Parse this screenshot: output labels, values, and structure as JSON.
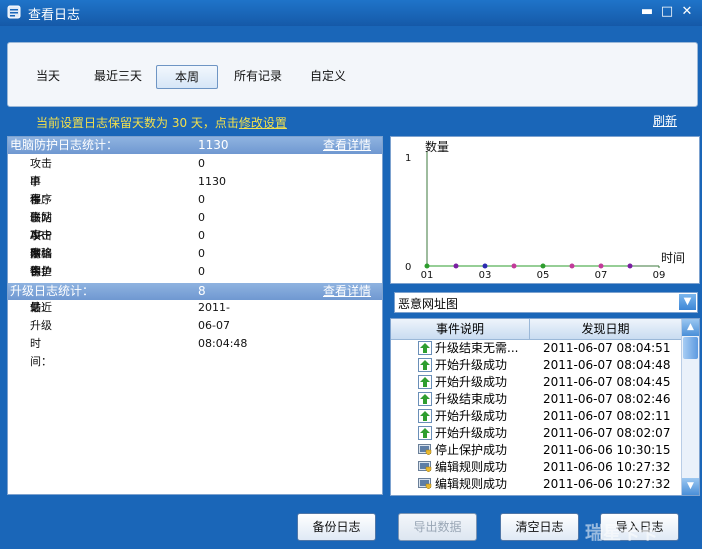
{
  "window": {
    "title": "查看日志"
  },
  "tabs": [
    "当天",
    "最近三天",
    "本周",
    "所有记录",
    "自定义"
  ],
  "active_tab": "本周",
  "notice": {
    "prefix": "当前设置日志保留天数为 30 天，点击",
    "link": "修改设置"
  },
  "refresh_label": "刷新",
  "protection": {
    "header": "电脑防护日志统计：",
    "total": "1130",
    "detail_link": "查看详情",
    "rows": [
      {
        "label": "攻击事件：",
        "value": "0"
      },
      {
        "label": "IP 事件：",
        "value": "1130"
      },
      {
        "label": "程序联网事件：",
        "value": "0"
      },
      {
        "label": "出站攻击事件：",
        "value": "0"
      },
      {
        "label": "ARP 欺骗事件：",
        "value": "0"
      },
      {
        "label": "网络保护事件：",
        "value": "0"
      },
      {
        "label": "钓鱼网站：",
        "value": "0"
      }
    ]
  },
  "upgrade": {
    "header": "升级日志统计：",
    "total": "8",
    "detail_link": "查看详情",
    "rows": [
      {
        "label": "最近升级时间：",
        "value": "2011-06-07 08:04:48"
      }
    ]
  },
  "chart_data": {
    "type": "line",
    "ylabel": "数量",
    "xlabel": "时间",
    "yticks": [
      "0",
      "1"
    ],
    "xticks": [
      "01",
      "03",
      "05",
      "07",
      "09"
    ],
    "ylim": [
      0,
      1
    ],
    "xlim": [
      0,
      8
    ],
    "series": [
      {
        "x": [
          0,
          1,
          2,
          3,
          4,
          5,
          6,
          7
        ],
        "values": [
          0,
          0,
          0,
          0,
          0,
          0,
          0,
          0
        ],
        "point_colors": [
          "#2e9d2e",
          "#7a1fa2",
          "#2b2bb0",
          "#c23b9a",
          "#2e9d2e",
          "#c23b9a",
          "#c23b9a",
          "#7a1fa2"
        ]
      }
    ]
  },
  "chart_selector": "恶意网址图",
  "events": {
    "col_desc": "事件说明",
    "col_date": "发现日期",
    "rows": [
      {
        "icon": "upgrade-icon",
        "desc": "升级结束无需...",
        "date": "2011-06-07 08:04:51"
      },
      {
        "icon": "upgrade-icon",
        "desc": "开始升级成功",
        "date": "2011-06-07 08:04:48"
      },
      {
        "icon": "upgrade-icon",
        "desc": "开始升级成功",
        "date": "2011-06-07 08:04:45"
      },
      {
        "icon": "upgrade-icon",
        "desc": "升级结束成功",
        "date": "2011-06-07 08:02:46"
      },
      {
        "icon": "upgrade-icon",
        "desc": "开始升级成功",
        "date": "2011-06-07 08:02:11"
      },
      {
        "icon": "upgrade-icon",
        "desc": "开始升级成功",
        "date": "2011-06-07 08:02:07"
      },
      {
        "icon": "shield-monitor-icon",
        "desc": "停止保护成功",
        "date": "2011-06-06 10:30:15"
      },
      {
        "icon": "shield-monitor-icon",
        "desc": "编辑规则成功",
        "date": "2011-06-06 10:27:32"
      },
      {
        "icon": "shield-monitor-icon",
        "desc": "编辑规则成功",
        "date": "2011-06-06 10:27:32"
      }
    ]
  },
  "buttons": {
    "backup": "备份日志",
    "export": "导出数据",
    "clear": "清空日志",
    "import": "导入日志"
  },
  "watermark": "瑞星卡卡"
}
